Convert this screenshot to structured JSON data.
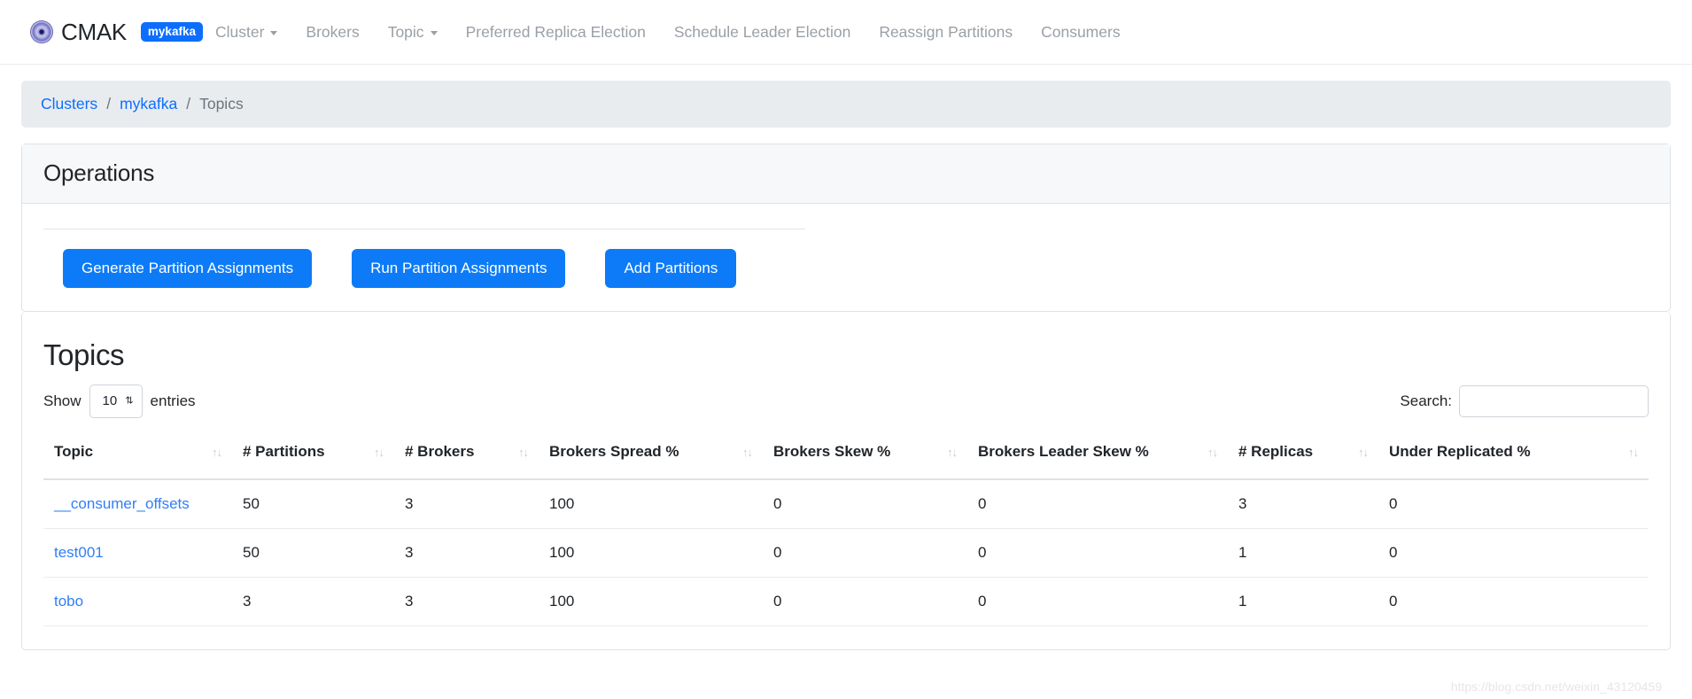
{
  "navbar": {
    "brand": "CMAK",
    "cluster_badge": "mykafka",
    "links": [
      {
        "label": "Cluster",
        "has_caret": true
      },
      {
        "label": "Brokers",
        "has_caret": false
      },
      {
        "label": "Topic",
        "has_caret": true
      },
      {
        "label": "Preferred Replica Election",
        "has_caret": false
      },
      {
        "label": "Schedule Leader Election",
        "has_caret": false
      },
      {
        "label": "Reassign Partitions",
        "has_caret": false
      },
      {
        "label": "Consumers",
        "has_caret": false
      }
    ]
  },
  "breadcrumb": {
    "items": [
      "Clusters",
      "mykafka",
      "Topics"
    ],
    "separator": "/"
  },
  "operations": {
    "title": "Operations",
    "buttons": [
      "Generate Partition Assignments",
      "Run Partition Assignments",
      "Add Partitions"
    ]
  },
  "topics": {
    "title": "Topics",
    "length_label_before": "Show",
    "length_label_after": "entries",
    "length_value": "10",
    "spinner_glyph": "⇅",
    "search_label": "Search:",
    "search_value": "",
    "search_placeholder": "",
    "sort_glyph": "↑↓",
    "columns": [
      "Topic",
      "# Partitions",
      "# Brokers",
      "Brokers Spread %",
      "Brokers Skew %",
      "Brokers Leader Skew %",
      "# Replicas",
      "Under Replicated %"
    ],
    "rows": [
      {
        "topic": "__consumer_offsets",
        "partitions": "50",
        "brokers": "3",
        "brokers_spread": "100",
        "brokers_skew": "0",
        "brokers_leader_skew": "0",
        "replicas": "3",
        "under_replicated": "0"
      },
      {
        "topic": "test001",
        "partitions": "50",
        "brokers": "3",
        "brokers_spread": "100",
        "brokers_skew": "0",
        "brokers_leader_skew": "0",
        "replicas": "1",
        "under_replicated": "0"
      },
      {
        "topic": "tobo",
        "partitions": "3",
        "brokers": "3",
        "brokers_spread": "100",
        "brokers_skew": "0",
        "brokers_leader_skew": "0",
        "replicas": "1",
        "under_replicated": "0"
      }
    ]
  },
  "watermark": "https://blog.csdn.net/weixin_43120459",
  "colors": {
    "primary": "#0d6efd",
    "button": "#0d7bf7",
    "link": "#2f7ff7",
    "breadcrumb_bg": "#e9ecef",
    "nav_link": "#9aa0a6"
  }
}
